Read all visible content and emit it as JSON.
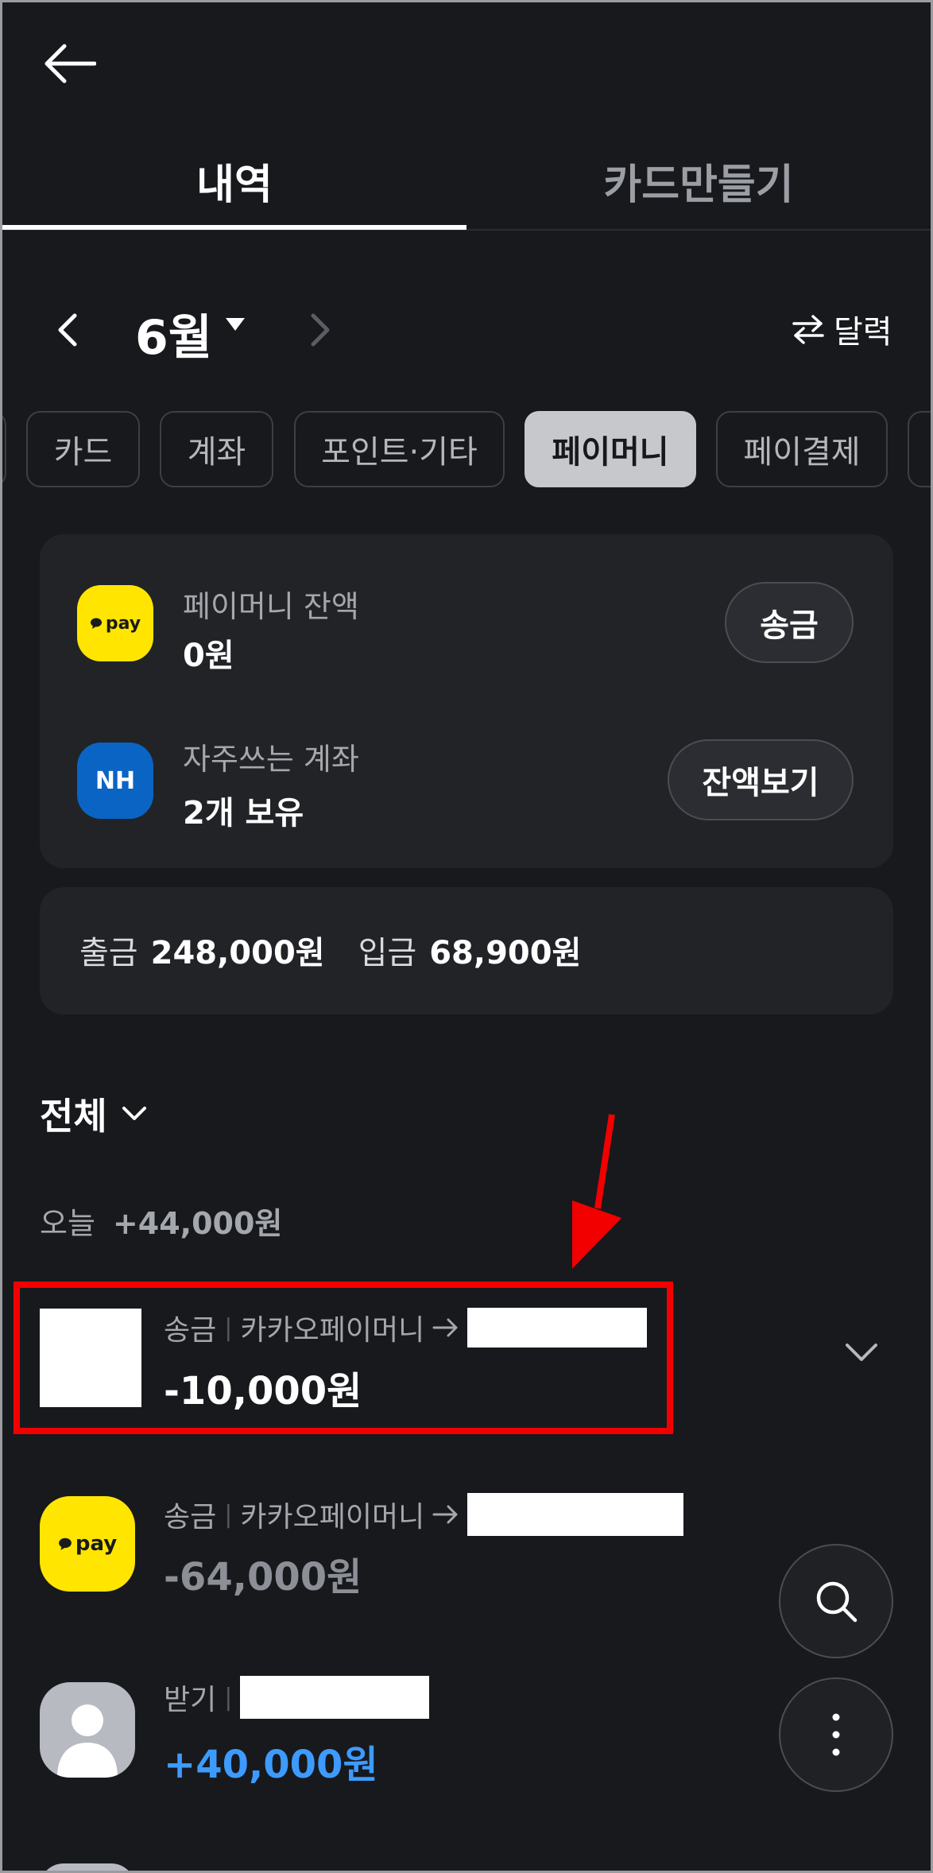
{
  "header": {
    "back_label": "back",
    "tabs": [
      {
        "label": "내역",
        "active": true
      },
      {
        "label": "카드만들기",
        "active": false
      }
    ]
  },
  "month_nav": {
    "month": "6월",
    "calendar_toggle": "달력"
  },
  "chips": [
    {
      "label": "카드",
      "active": false
    },
    {
      "label": "계좌",
      "active": false
    },
    {
      "label": "포인트·기타",
      "active": false
    },
    {
      "label": "페이머니",
      "active": true
    },
    {
      "label": "페이결제",
      "active": false
    }
  ],
  "wallet": {
    "paymoney": {
      "icon_text": "pay",
      "label": "페이머니 잔액",
      "value": "0원",
      "button": "송금"
    },
    "account": {
      "icon_text": "NH",
      "label": "자주쓰는 계좌",
      "value": "2개 보유",
      "button": "잔액보기"
    }
  },
  "summary": {
    "out_label": "출금",
    "out_value": "248,000원",
    "in_label": "입금",
    "in_value": "68,900원"
  },
  "filter": {
    "label": "전체"
  },
  "day": {
    "label": "오늘",
    "total": "+44,000원"
  },
  "transactions": [
    {
      "type": "송금",
      "desc": "카카오페이머니",
      "amount": "-10,000원",
      "amount_color": "#ffffff",
      "thumb": "redacted"
    },
    {
      "type": "송금",
      "desc": "카카오페이머니",
      "amount": "-64,000원",
      "amount_color": "#8c8f95",
      "thumb": "pay",
      "thumb_text": "pay"
    },
    {
      "type": "받기",
      "desc": "",
      "amount": "+40,000원",
      "amount_color": "#3d9bff",
      "thumb": "avatar"
    }
  ],
  "colors": {
    "background": "#17191d",
    "card": "#212327",
    "pay_yellow": "#ffe500",
    "nh_blue": "#0a64c4",
    "highlight_red": "#f20000",
    "income_blue": "#3d9bff"
  }
}
